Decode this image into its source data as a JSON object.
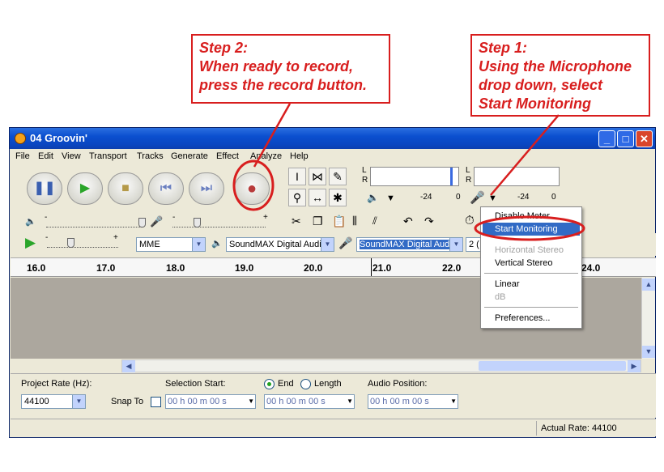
{
  "callouts": {
    "step2": [
      "Step 2:",
      "When ready to record,",
      "press the record button."
    ],
    "step1": [
      "Step 1:",
      "Using the Microphone",
      "drop down, select",
      "Start Monitoring"
    ]
  },
  "accent_color": "#d81e1e",
  "window": {
    "title": "04 Groovin'",
    "min": "_",
    "max": "□",
    "close": "✕"
  },
  "menu": [
    "File",
    "Edit",
    "View",
    "Transport",
    "Tracks",
    "Generate",
    "Effect",
    "Analyze",
    "Help"
  ],
  "transport": {
    "icons": [
      "pause-icon",
      "play-icon",
      "stop-icon",
      "skip-start-icon",
      "skip-end-icon",
      "record-icon"
    ]
  },
  "meters": {
    "L": "L",
    "R": "R",
    "play_db_left": "-24",
    "play_db_right": "0",
    "rec_db_left": "-24",
    "rec_db_right": "0"
  },
  "mixer": {
    "minus": "-",
    "plus": "+"
  },
  "device": {
    "host": "MME",
    "playback": "SoundMAX Digital Audio",
    "recording": "SoundMAX Digital Audio",
    "channels": "2 ("
  },
  "ruler": [
    "16.0",
    "17.0",
    "18.0",
    "19.0",
    "20.0",
    "21.0",
    "22.0",
    "24.0"
  ],
  "dropdown": {
    "items": [
      "Disable Meter",
      "Start Monitoring",
      "Horizontal Stereo",
      "Vertical Stereo",
      "Linear",
      "dB",
      "Preferences..."
    ],
    "highlighted": "Start Monitoring"
  },
  "selection": {
    "project_rate_label": "Project Rate (Hz):",
    "project_rate": "44100",
    "snap_to": "Snap To",
    "selection_start": "Selection Start:",
    "end": "End",
    "length": "Length",
    "audio_position": "Audio Position:",
    "time_value": "00 h 00 m 00 s"
  },
  "status": {
    "actual_rate": "Actual Rate: 44100"
  }
}
